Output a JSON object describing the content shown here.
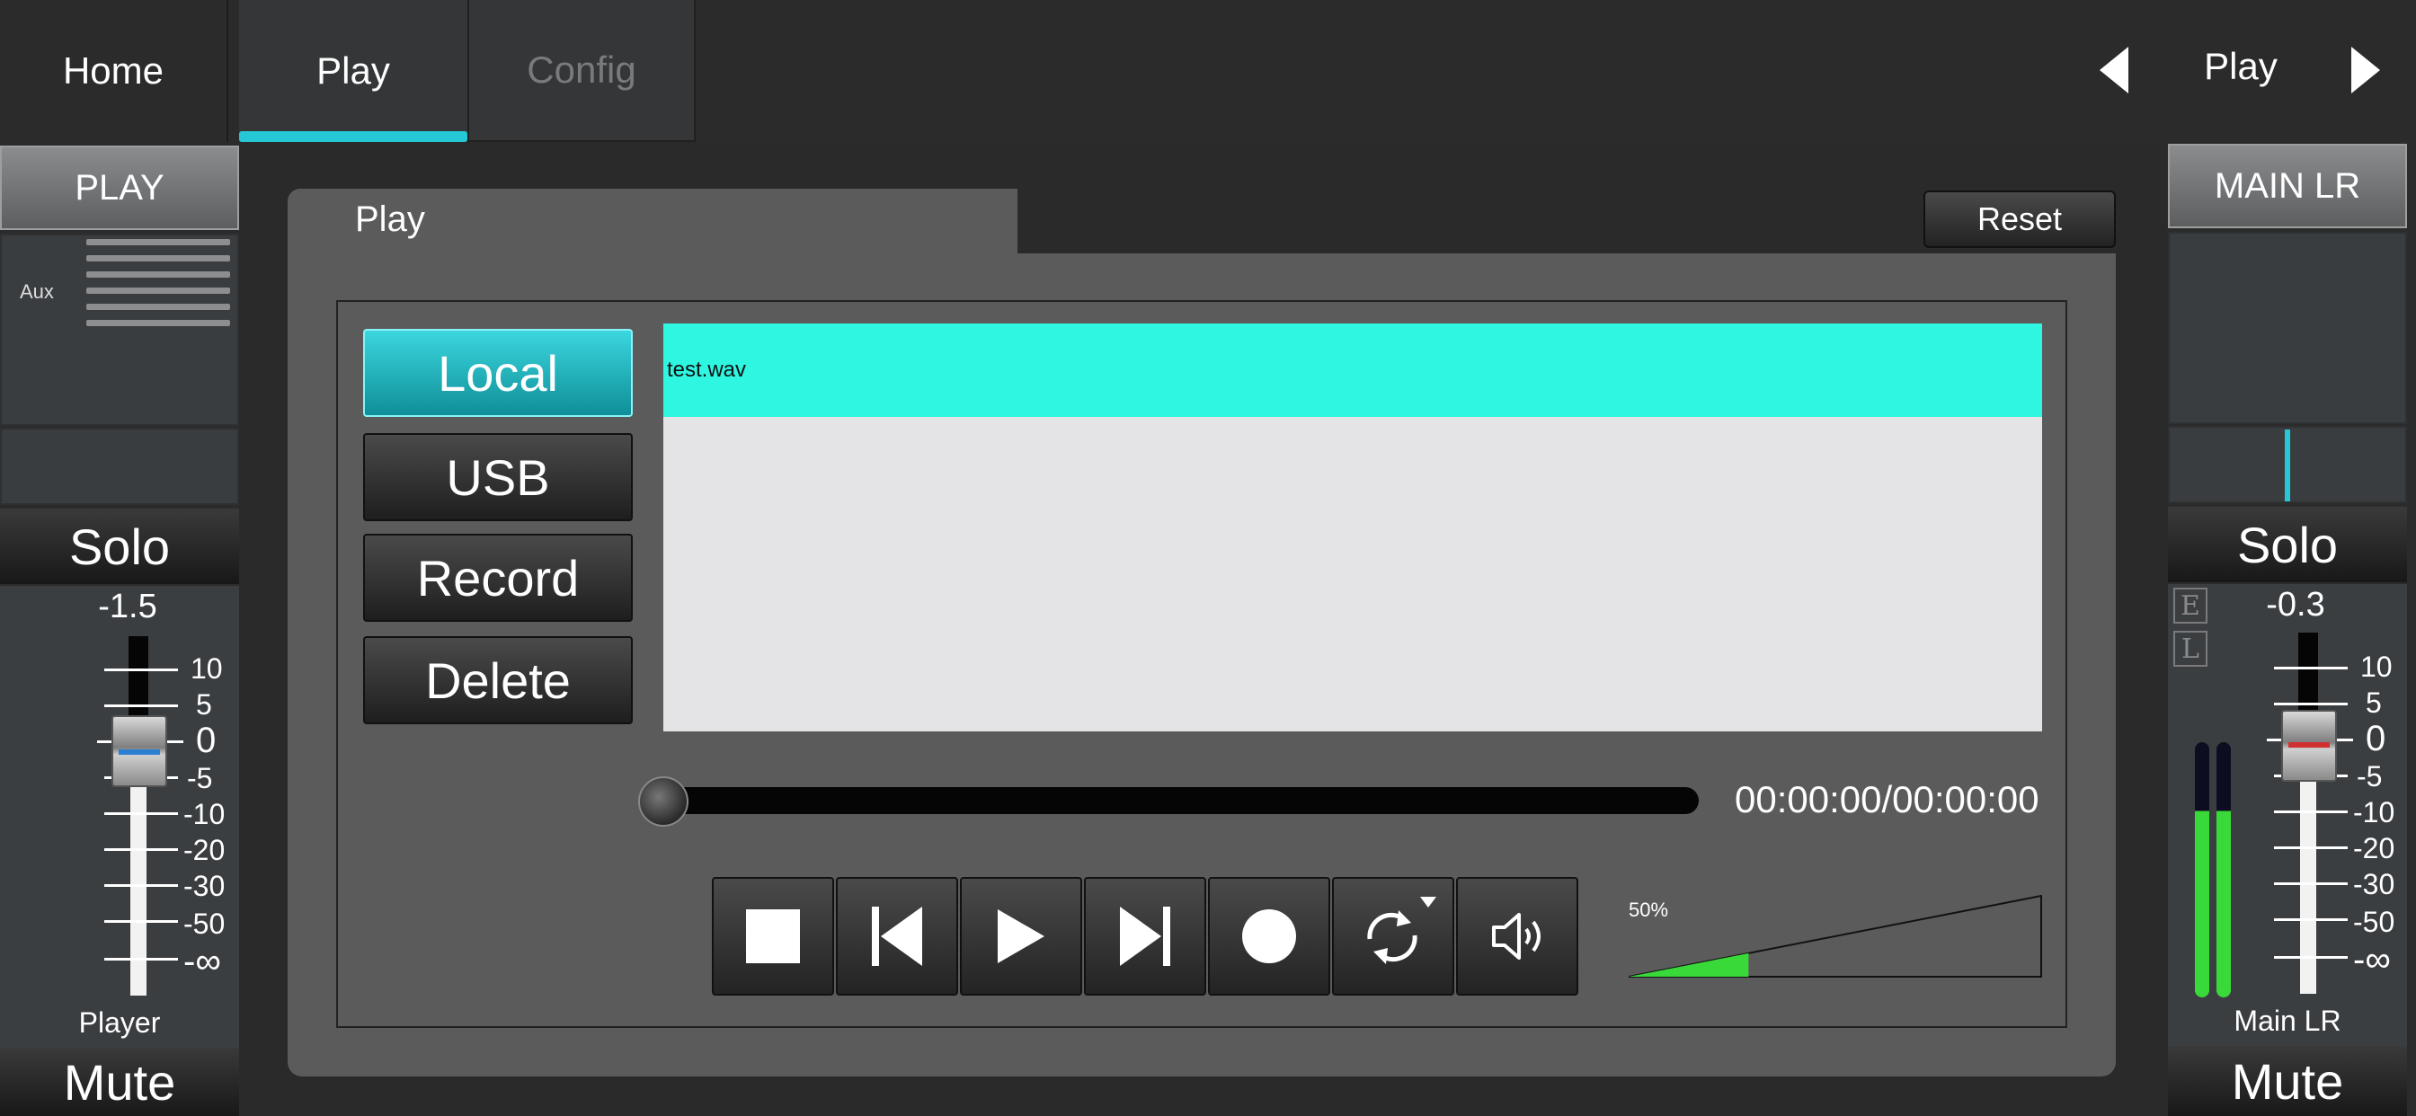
{
  "tabs": {
    "home": "Home",
    "play": "Play",
    "config": "Config"
  },
  "nav": {
    "current": "Play"
  },
  "left_strip": {
    "button": "PLAY",
    "aux_label": "Aux",
    "solo": "Solo",
    "value": "-1.5",
    "name": "Player",
    "mute": "Mute"
  },
  "right_strip": {
    "button": "MAIN LR",
    "solo": "Solo",
    "value": "-0.3",
    "badge_e": "E",
    "badge_l": "L",
    "name": "Main LR",
    "mute": "Mute"
  },
  "scale": {
    "s10": "10",
    "s5": "5",
    "s0": "0",
    "sm5": "-5",
    "sm10": "-10",
    "sm20": "-20",
    "sm30": "-30",
    "sm50": "-50",
    "sinf": "-∞"
  },
  "panel": {
    "title": "Play",
    "reset": "Reset",
    "sources": {
      "local": "Local",
      "usb": "USB",
      "record": "Record",
      "delete": "Delete"
    },
    "file": "test.wav",
    "time": "00:00:00/00:00:00",
    "volume_label": "50%",
    "volume_level": 0.5
  },
  "icons": {
    "stop": "stop-icon",
    "prev": "skip-previous-icon",
    "play": "play-icon",
    "next": "skip-next-icon",
    "record": "record-icon",
    "loop": "loop-icon",
    "volume": "speaker-icon"
  },
  "colors": {
    "accent": "#25c8d4",
    "selected_row": "#2ef6e0",
    "meter_green": "#3ad93a"
  }
}
